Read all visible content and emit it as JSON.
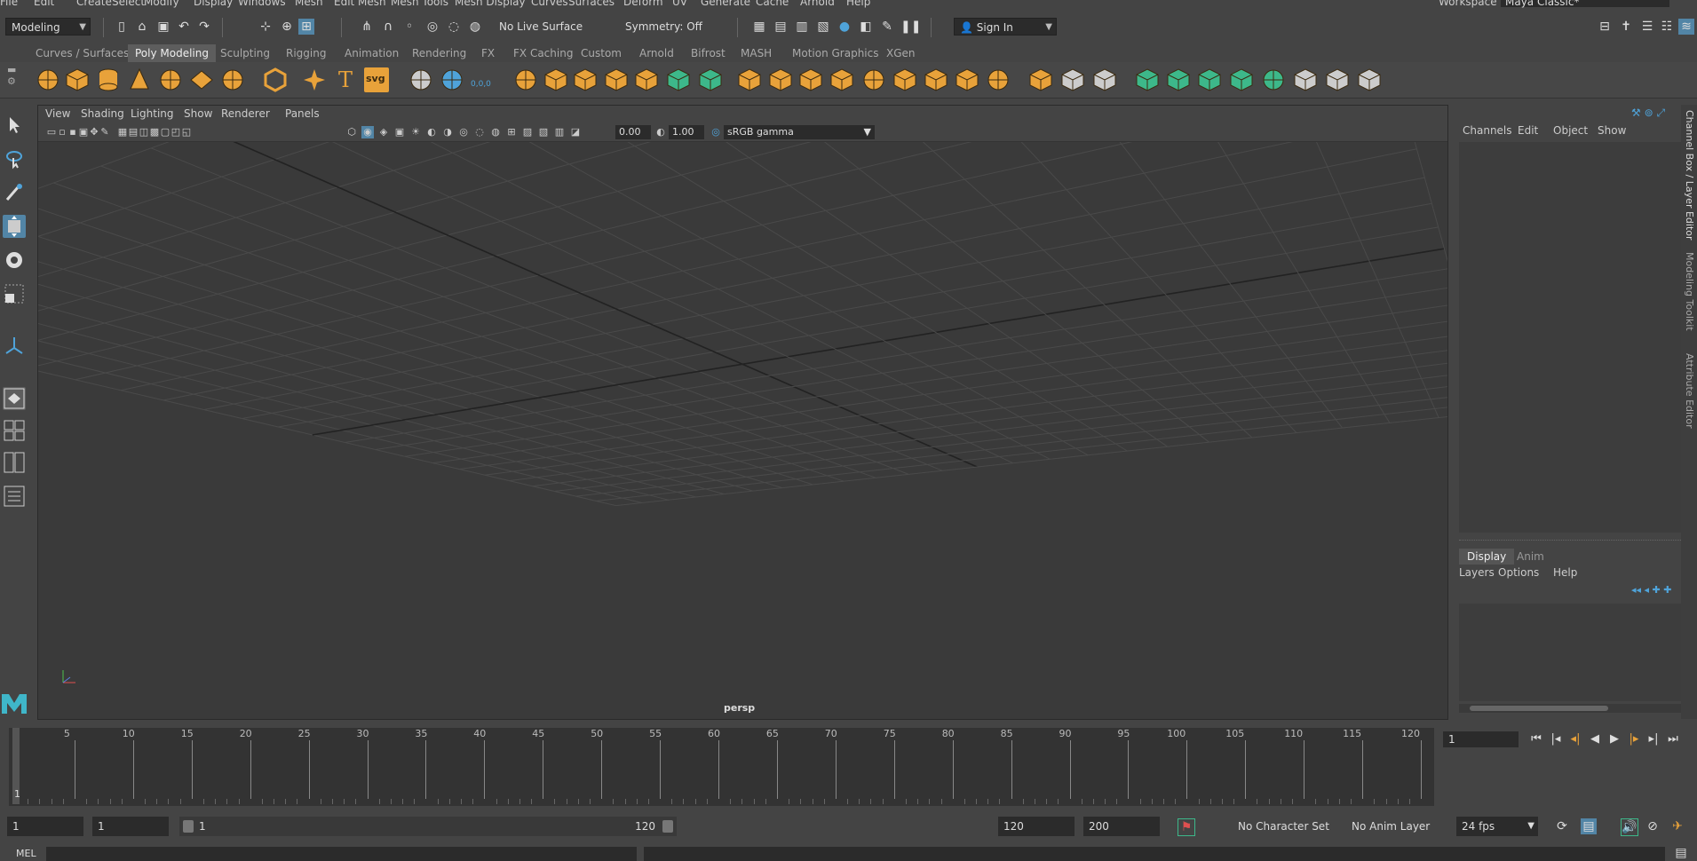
{
  "menubar": {
    "items": [
      "File",
      "Edit",
      "Create",
      "Select",
      "Modify",
      "Display",
      "Windows",
      "Mesh",
      "Edit Mesh",
      "Mesh Tools",
      "Mesh Display",
      "Curves",
      "Surfaces",
      "Deform",
      "UV",
      "Generate",
      "Cache",
      "Arnold",
      "Help"
    ],
    "workspace_label": "Workspace :",
    "workspace_value": "Maya Classic*"
  },
  "statusline": {
    "menuset": "Modeling",
    "live_surface": "No Live Surface",
    "symmetry": "Symmetry: Off",
    "sign_in": "Sign In"
  },
  "shelf": {
    "tabs": [
      "Curves / Surfaces",
      "Poly Modeling",
      "Sculpting",
      "Rigging",
      "Animation",
      "Rendering",
      "FX",
      "FX Caching",
      "Custom",
      "Arnold",
      "Bifrost",
      "MASH",
      "Motion Graphics",
      "XGen"
    ],
    "active_tab": "Poly Modeling",
    "svg_label": "svg",
    "text_label": "T",
    "zero_label": "0,0,0"
  },
  "viewport": {
    "menus": [
      "View",
      "Shading",
      "Lighting",
      "Show",
      "Renderer",
      "Panels"
    ],
    "exposure": "0.00",
    "gamma": "1.00",
    "colorspace": "sRGB gamma",
    "camera": "persp"
  },
  "channelbox": {
    "menus": [
      "Channels",
      "Edit",
      "Object",
      "Show"
    ],
    "layer_tabs": [
      "Display",
      "Anim"
    ],
    "layer_menus": [
      "Layers",
      "Options",
      "Help"
    ],
    "side_tabs": [
      "Channel Box / Layer Editor",
      "Modeling Toolkit",
      "Attribute Editor"
    ]
  },
  "timeslider": {
    "ticks": [
      "5",
      "10",
      "15",
      "20",
      "25",
      "30",
      "35",
      "40",
      "45",
      "50",
      "55",
      "60",
      "65",
      "70",
      "75",
      "80",
      "85",
      "90",
      "95",
      "100",
      "105",
      "110",
      "115",
      "120"
    ],
    "current_frame_marker": "1",
    "current_frame": "1"
  },
  "rangebar": {
    "start": "1",
    "playback_start": "1",
    "range_start": "1",
    "range_end": "120",
    "playback_end": "120",
    "end": "200",
    "character_set": "No Character Set",
    "anim_layer": "No Anim Layer",
    "fps": "24 fps"
  },
  "cmdline": {
    "label": "MEL"
  },
  "colors": {
    "accent_orange": "#e8a23a",
    "accent_green": "#3db88a",
    "accent_blue": "#4fa3d9",
    "active_tool": "#5285a6"
  }
}
